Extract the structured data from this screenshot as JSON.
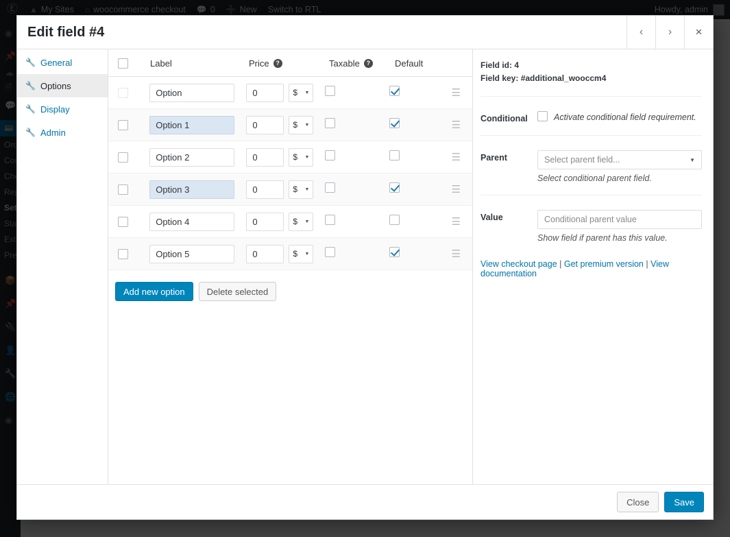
{
  "adminbar": {
    "logo_icon": "wordpress-logo-icon",
    "items": [
      {
        "label": "My Sites",
        "icon": "sites-icon"
      },
      {
        "label": "woocommerce checkout",
        "icon": "home-icon"
      },
      {
        "label": "0",
        "icon": "comment-icon"
      },
      {
        "label": "New",
        "icon": "plus-icon"
      },
      {
        "label": "Switch to RTL",
        "icon": ""
      }
    ],
    "howdy": "Howdy, admin"
  },
  "wp_sidebar": {
    "icons": [
      "dashboard-icon",
      "posts-pin-icon",
      "media-icon",
      "pages-icon",
      "comments-icon"
    ],
    "current_icon": "woocommerce-icon",
    "submenu": [
      {
        "label": "Orders",
        "current": false
      },
      {
        "label": "Coupons",
        "current": false
      },
      {
        "label": "Checkout",
        "current": false
      },
      {
        "label": "Reports",
        "current": false
      },
      {
        "label": "Settings",
        "current": true
      },
      {
        "label": "Status",
        "current": false
      },
      {
        "label": "Extensions",
        "current": false
      },
      {
        "label": "Premium",
        "current": false
      }
    ],
    "lower_icons": [
      "products-icon",
      "appearance-pin-icon",
      "plugins-icon",
      "users-icon",
      "tools-wrench-icon",
      "settings-icon",
      "collapse-icon"
    ]
  },
  "modal": {
    "title": "Edit field #4",
    "header_buttons": [
      {
        "name": "prev",
        "glyph": "‹"
      },
      {
        "name": "next",
        "glyph": "›"
      },
      {
        "name": "close",
        "glyph": "×"
      }
    ],
    "nav": [
      {
        "label": "General",
        "icon": "wrench-icon",
        "active": false
      },
      {
        "label": "Options",
        "icon": "wrench-icon",
        "active": true
      },
      {
        "label": "Display",
        "icon": "wrench-icon",
        "active": false
      },
      {
        "label": "Admin",
        "icon": "wrench-icon",
        "active": false
      }
    ],
    "table": {
      "headers": {
        "label": "Label",
        "price": "Price",
        "taxable": "Taxable",
        "default": "Default",
        "help_glyph": "?"
      },
      "select_all_checked": false,
      "rows": [
        {
          "label": "Option",
          "price": "0",
          "currency": "$",
          "select_checked": false,
          "select_faded": true,
          "taxable": false,
          "default": true,
          "label_highlight": false,
          "alt": false
        },
        {
          "label": "Option 1",
          "price": "0",
          "currency": "$",
          "select_checked": false,
          "select_faded": false,
          "taxable": false,
          "default": true,
          "label_highlight": true,
          "alt": true
        },
        {
          "label": "Option 2",
          "price": "0",
          "currency": "$",
          "select_checked": false,
          "select_faded": false,
          "taxable": false,
          "default": false,
          "label_highlight": false,
          "alt": false
        },
        {
          "label": "Option 3",
          "price": "0",
          "currency": "$",
          "select_checked": false,
          "select_faded": false,
          "taxable": false,
          "default": true,
          "label_highlight": true,
          "alt": true
        },
        {
          "label": "Option 4",
          "price": "0",
          "currency": "$",
          "select_checked": false,
          "select_faded": false,
          "taxable": false,
          "default": false,
          "label_highlight": false,
          "alt": false
        },
        {
          "label": "Option 5",
          "price": "0",
          "currency": "$",
          "select_checked": false,
          "select_faded": false,
          "taxable": false,
          "default": true,
          "label_highlight": false,
          "alt": true
        }
      ]
    },
    "actions": {
      "add": "Add new option",
      "delete": "Delete selected"
    },
    "side": {
      "field_id_label": "Field id:",
      "field_id_value": "4",
      "field_key_label": "Field key:",
      "field_key_value": "#additional_wooccm4",
      "conditional_label": "Conditional",
      "conditional_hint": "Activate conditional field requirement.",
      "conditional_checked": false,
      "parent_label": "Parent",
      "parent_placeholder": "Select parent field...",
      "parent_hint": "Select conditional parent field.",
      "value_label": "Value",
      "value_placeholder": "Conditional parent value",
      "value_hint": "Show field if parent has this value.",
      "links": [
        "View checkout page",
        "Get premium version",
        "View documentation"
      ],
      "link_sep": "|"
    },
    "footer": {
      "close": "Close",
      "save": "Save"
    }
  },
  "colors": {
    "accent": "#0073aa",
    "primary_button": "#0085ba",
    "adminbar_bg": "#23282d",
    "highlight_input": "#dbe6f3"
  }
}
